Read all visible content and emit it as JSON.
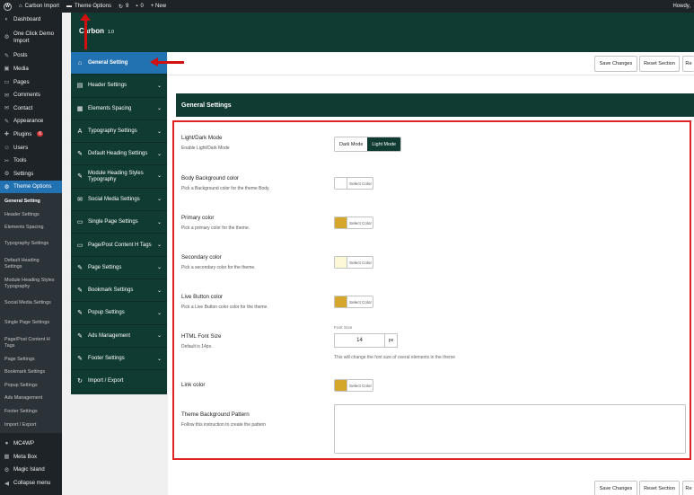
{
  "adminbar": {
    "site_name": "Carbon Import",
    "theme_options": "Theme Options",
    "updates_count": "9",
    "comments_count": "0",
    "new_label": "+ New",
    "howdy": "Howdy,"
  },
  "wp_menu": {
    "items": [
      {
        "icon": "◐",
        "label": "Dashboard"
      },
      {
        "icon": "⚙",
        "label": "One Click Demo Import"
      },
      {
        "icon": "✎",
        "label": "Posts"
      },
      {
        "icon": "▣",
        "label": "Media"
      },
      {
        "icon": "▭",
        "label": "Pages"
      },
      {
        "icon": "✉",
        "label": "Comments"
      },
      {
        "icon": "✉",
        "label": "Contact"
      },
      {
        "icon": "✎",
        "label": "Appearance"
      },
      {
        "icon": "✚",
        "label": "Plugins",
        "badge": "6"
      },
      {
        "icon": "☺",
        "label": "Users"
      },
      {
        "icon": "✂",
        "label": "Tools"
      },
      {
        "icon": "⚙",
        "label": "Settings"
      },
      {
        "icon": "⚙",
        "label": "Theme Options"
      }
    ],
    "sub_items": [
      "General Setting",
      "Header Settings",
      "Elements Spacing",
      "Typography Settings",
      "Default Heading Settings",
      "Module Heading Styles Typography",
      "Social Media Settings",
      "Single Page Settings",
      "Page/Post Content H Tags",
      "Page Settings",
      "Bookmark Settings",
      "Popup Settings",
      "Ads Management",
      "Footer Settings",
      "Import / Export"
    ],
    "bottom_items": [
      {
        "icon": "●",
        "label": "MC4WP"
      },
      {
        "icon": "▦",
        "label": "Meta Box"
      },
      {
        "icon": "⚙",
        "label": "Magic Island"
      },
      {
        "icon": "◀",
        "label": "Collapse menu"
      }
    ]
  },
  "plugin": {
    "title": "Carbon",
    "version": "1.0"
  },
  "plugin_nav": [
    {
      "icon": "⌂",
      "label": "General Setting"
    },
    {
      "icon": "▤",
      "label": "Header Settings"
    },
    {
      "icon": "▦",
      "label": "Elements Spacing"
    },
    {
      "icon": "A",
      "label": "Typography Settings"
    },
    {
      "icon": "✎",
      "label": "Default Heading Settings"
    },
    {
      "icon": "✎",
      "label": "Module Heading Styles Typography"
    },
    {
      "icon": "✉",
      "label": "Social Media Settings"
    },
    {
      "icon": "▭",
      "label": "Single Page Settings"
    },
    {
      "icon": "▭",
      "label": "Page/Post Content H Tags"
    },
    {
      "icon": "✎",
      "label": "Page Settings"
    },
    {
      "icon": "✎",
      "label": "Bookmark Settings"
    },
    {
      "icon": "✎",
      "label": "Popup Settings"
    },
    {
      "icon": "✎",
      "label": "Ads Management"
    },
    {
      "icon": "✎",
      "label": "Footer Settings"
    },
    {
      "icon": "↻",
      "label": "Import / Export"
    }
  ],
  "toolbar": {
    "save_label": "Save Changes",
    "reset_section_label": "Reset Section",
    "reset_all_label": "Re"
  },
  "section": {
    "title": "General Settings"
  },
  "fields": {
    "mode": {
      "label": "Light/Dark Mode",
      "desc": "Enable Light/Dark Mode",
      "dark": "Dark Mode",
      "light": "Light Mode"
    },
    "body_bg": {
      "label": "Body Background color",
      "desc": "Pick a Background color for the theme Body.",
      "swatch": "#ffffff",
      "btn": "Select Color"
    },
    "primary": {
      "label": "Primary color",
      "desc": "Pick a primary color for the theme.",
      "swatch": "#d4a62a",
      "btn": "Select Color"
    },
    "secondary": {
      "label": "Secondary color",
      "desc": "Pick a secondary color for the theme.",
      "swatch": "#fdf8d8",
      "btn": "Select Color"
    },
    "live_button": {
      "label": "Live Button color",
      "desc": "Pick a Live Button color color for the theme.",
      "swatch": "#d4a62a",
      "btn": "Select Color"
    },
    "font_size": {
      "label": "HTML Font Size",
      "desc": "Default is 14px.",
      "top_label": "Font Size",
      "value": "14",
      "unit": "px",
      "help": "This will change the font size of overal elements in the theme"
    },
    "link": {
      "label": "Link color",
      "swatch": "#d4a62a",
      "btn": "Select Color"
    },
    "pattern": {
      "label": "Theme Background Pattern",
      "desc": "Follow this instruction to create the pattern"
    }
  },
  "colors": {
    "dark_green": "#0f3b32",
    "active_blue": "#2271b1",
    "highlight_red": "#e02424"
  }
}
